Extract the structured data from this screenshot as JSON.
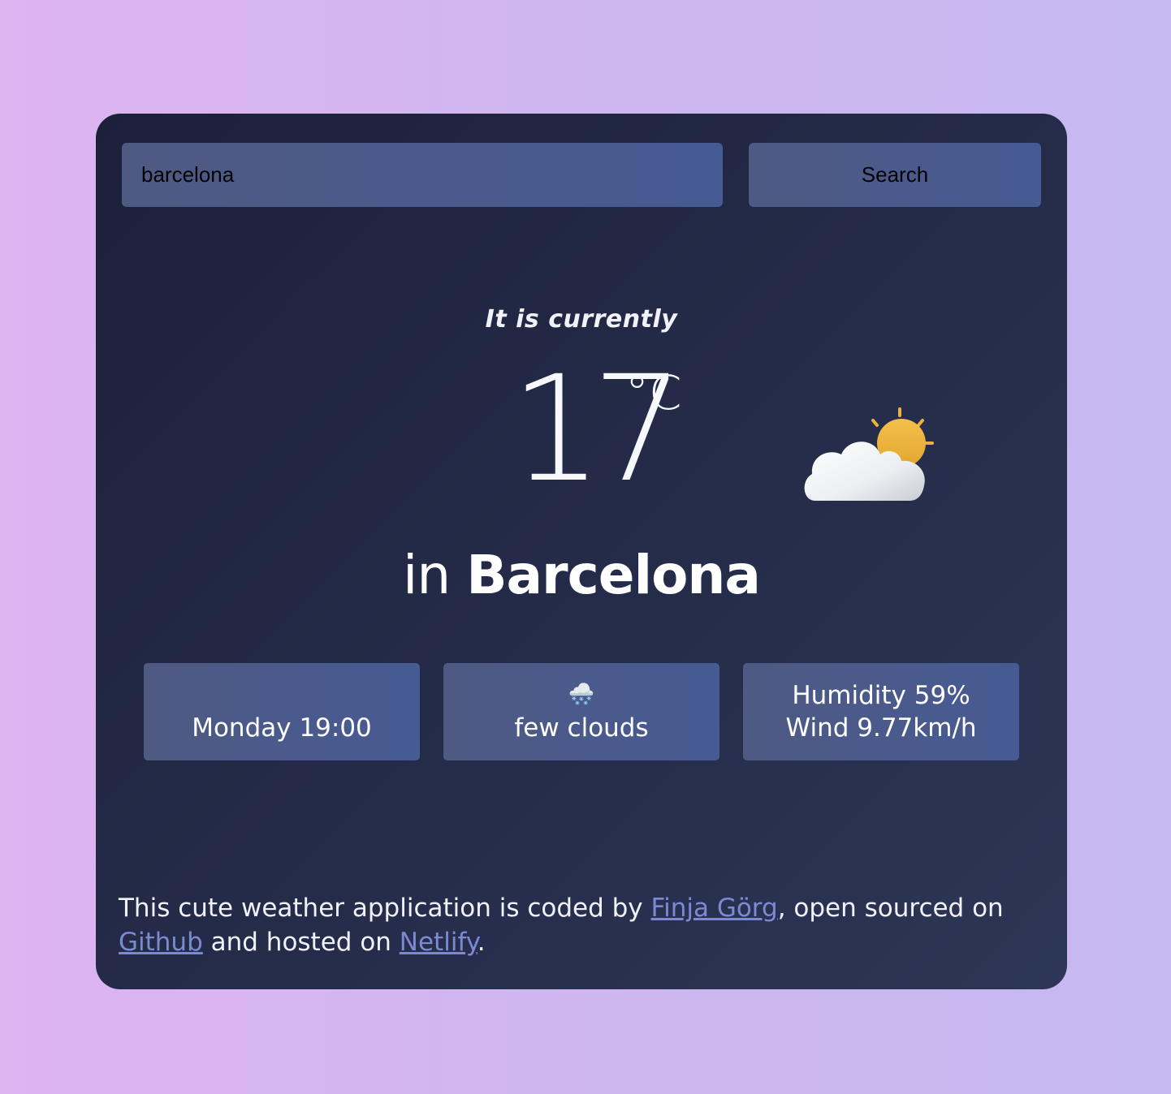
{
  "search": {
    "value": "barcelona",
    "button_label": "Search"
  },
  "current": {
    "intro": "It is currently",
    "temperature": "17",
    "unit": "°C",
    "prefix": "in",
    "city": "Barcelona",
    "icon": "partly-cloudy-icon"
  },
  "details": {
    "day_time": "Monday 19:00",
    "description_icon": "🌨️",
    "description": "few clouds",
    "humidity": "Humidity 59%",
    "wind": "Wind 9.77km/h"
  },
  "footer": {
    "text1": "This cute weather application is coded by ",
    "author_link": "Finja Görg",
    "text2": ", open sourced on ",
    "github_link": "Github",
    "text3": " and hosted on ",
    "netlify_link": "Netlify",
    "text4": "."
  },
  "colors": {
    "card_bg": "#1c2139",
    "accent_link": "#7b8ad1",
    "box_bg": "#4f5a83"
  }
}
